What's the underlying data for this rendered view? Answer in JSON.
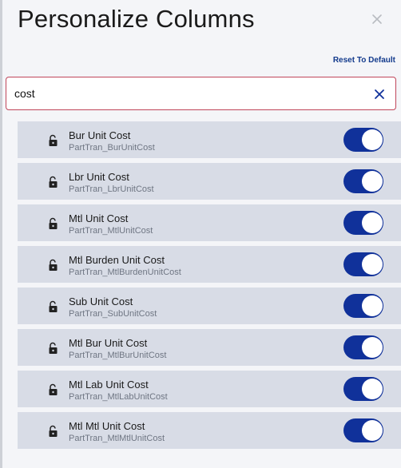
{
  "header": {
    "title": "Personalize Columns",
    "close_icon": "close-icon",
    "reset_label": "Reset To Default"
  },
  "search": {
    "value": "cost",
    "clear_icon": "clear-icon"
  },
  "colors": {
    "toggle_on": "#10319a",
    "row_bg": "#d8dce6",
    "search_border": "#c0465a",
    "link": "#123a8c"
  },
  "columns": [
    {
      "label": "Bur Unit Cost",
      "field": "PartTran_BurUnitCost",
      "enabled": true,
      "icon": "unlock-icon"
    },
    {
      "label": "Lbr Unit Cost",
      "field": "PartTran_LbrUnitCost",
      "enabled": true,
      "icon": "unlock-icon"
    },
    {
      "label": "Mtl Unit Cost",
      "field": "PartTran_MtlUnitCost",
      "enabled": true,
      "icon": "unlock-icon"
    },
    {
      "label": "Mtl Burden Unit Cost",
      "field": "PartTran_MtlBurdenUnitCost",
      "enabled": true,
      "icon": "unlock-icon"
    },
    {
      "label": "Sub Unit Cost",
      "field": "PartTran_SubUnitCost",
      "enabled": true,
      "icon": "unlock-icon"
    },
    {
      "label": "Mtl Bur Unit Cost",
      "field": "PartTran_MtlBurUnitCost",
      "enabled": true,
      "icon": "unlock-icon"
    },
    {
      "label": "Mtl Lab Unit Cost",
      "field": "PartTran_MtlLabUnitCost",
      "enabled": true,
      "icon": "unlock-icon"
    },
    {
      "label": "Mtl Mtl Unit Cost",
      "field": "PartTran_MtlMtlUnitCost",
      "enabled": true,
      "icon": "unlock-icon"
    }
  ]
}
